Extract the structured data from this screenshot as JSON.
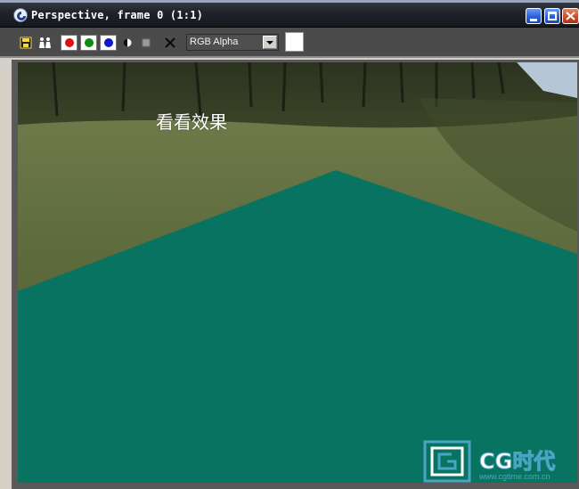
{
  "window": {
    "title": "Perspective, frame 0 (1:1)",
    "icon": "3dsmax-logo-icon",
    "controls": [
      "minimize-icon",
      "maximize-icon",
      "close-icon"
    ]
  },
  "toolbar": {
    "icons": [
      "save-image-icon",
      "clone-window-icon",
      "red-channel-button",
      "green-channel-button",
      "blue-channel-button",
      "monochrome-icon",
      "alpha-toggle-icon",
      "clear-icon"
    ],
    "channel_select": {
      "value": "RGB Alpha"
    },
    "swatch_color": "#ffffff"
  },
  "viewport": {
    "caption": "看看效果",
    "shape_color": "#087360",
    "watermark": {
      "brand": "CG时代",
      "url": "www.cgtime.com.cn"
    }
  }
}
